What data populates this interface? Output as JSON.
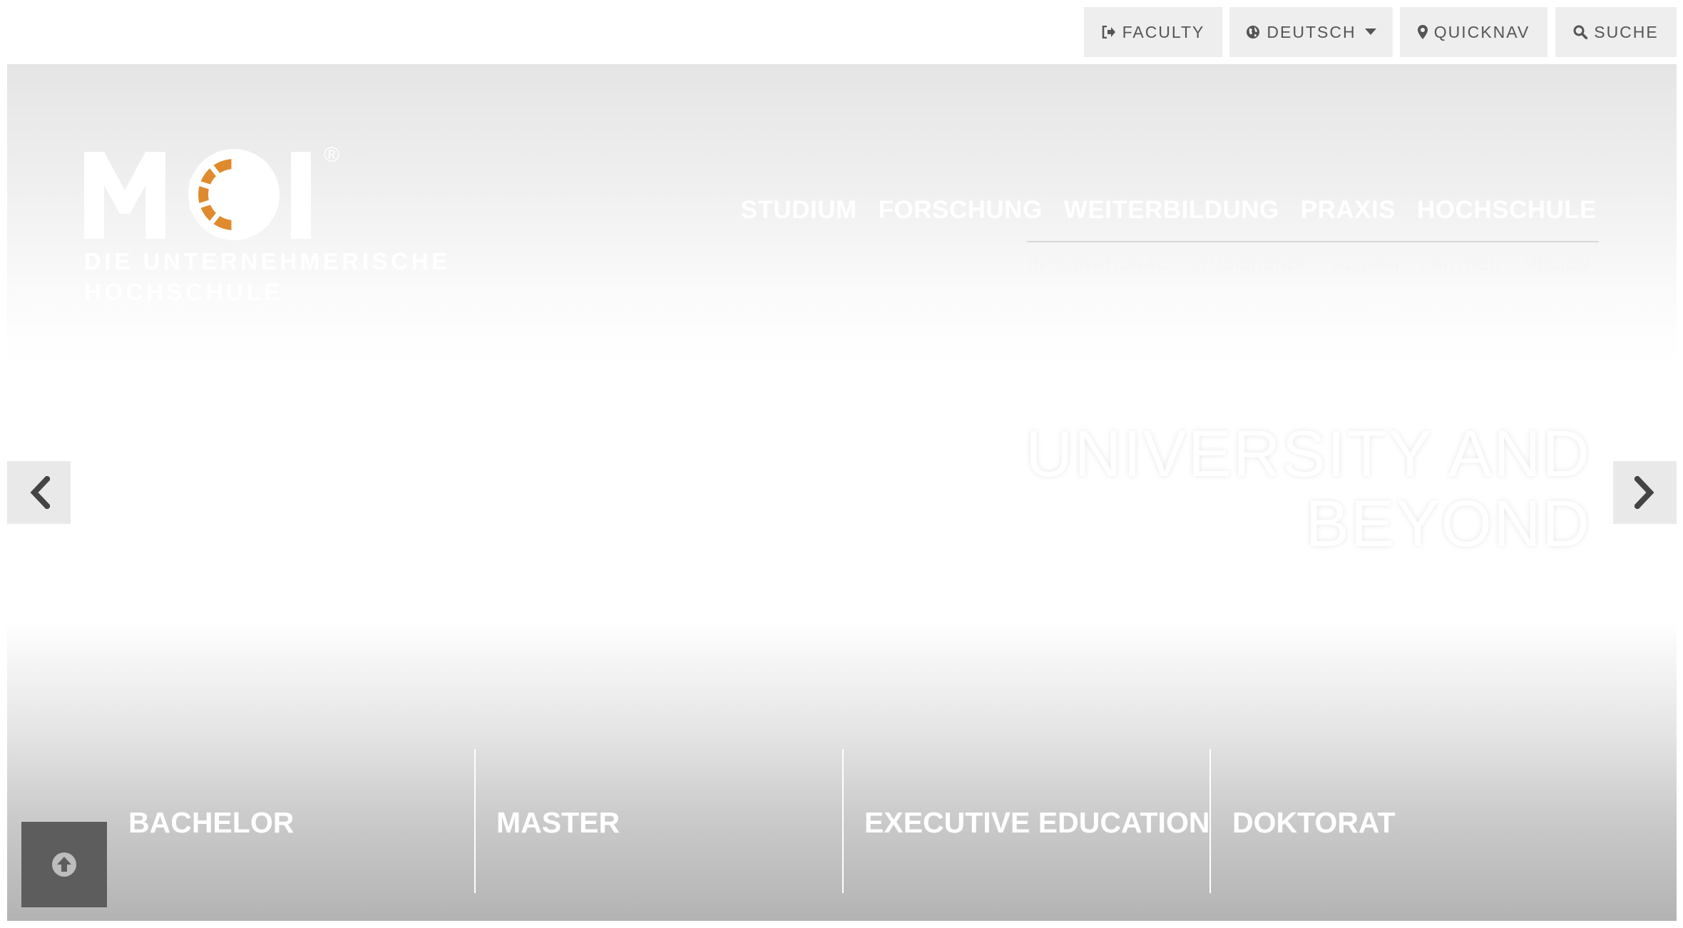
{
  "topbar": {
    "faculty": {
      "label": "FACULTY",
      "icon": "sign-in-icon"
    },
    "language": {
      "label": "DEUTSCH",
      "icon": "globe-icon"
    },
    "quicknav": {
      "label": "QUICKNAV",
      "icon": "map-marker-icon"
    },
    "search": {
      "label": "SUCHE",
      "icon": "search-icon"
    }
  },
  "logo": {
    "wordmark": "MCI",
    "registered": "®",
    "tagline_line1": "DIE UNTERNEHMERISCHE",
    "tagline_line2": "HOCHSCHULE",
    "accent_color": "#e08a2e"
  },
  "main_nav": [
    "STUDIUM",
    "FORSCHUNG",
    "WEITERBILDUNG",
    "PRAXIS",
    "HOCHSCHULE"
  ],
  "sub_nav": [
    "INTERNATIONAL",
    "STUDIERENDE",
    "ALUMNI",
    "PARTNER",
    "MEDIEN"
  ],
  "hero": {
    "headline_line1": "UNIVERSITY AND",
    "headline_line2": "BEYOND"
  },
  "slider": {
    "prev_icon": "chevron-left-icon",
    "next_icon": "chevron-right-icon"
  },
  "programs": [
    "BACHELOR",
    "MASTER",
    "EXECUTIVE EDUCATION",
    "DOKTORAT"
  ],
  "back_to_top": {
    "icon": "arrow-circle-up-icon"
  },
  "colors": {
    "button_bg": "#eeeeee",
    "button_text": "#555555",
    "back_to_top_bg": "#5d5d5d"
  }
}
